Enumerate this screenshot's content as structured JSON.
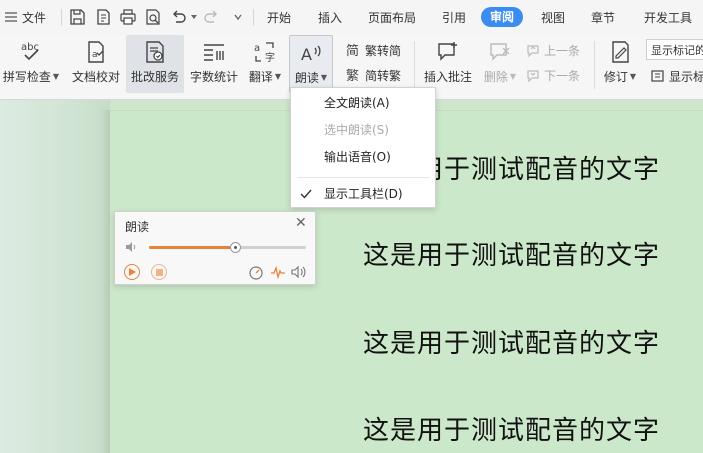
{
  "menubar": {
    "file_label": "文件",
    "tabs": [
      "开始",
      "插入",
      "页面布局",
      "引用",
      "审阅",
      "视图",
      "章节",
      "开发工具"
    ],
    "active_tab": "审阅"
  },
  "ribbon": {
    "spellcheck": "拼写检查",
    "doc_compare": "文档校对",
    "review_service": "批改服务",
    "word_count": "字数统计",
    "translate": "翻译",
    "read_aloud": "朗读",
    "trad_to_simp": "繁转简",
    "simp_to_trad": "简转繁",
    "insert_comment": "插入批注",
    "delete": "删除",
    "prev": "上一条",
    "next": "下一条",
    "revision": "修订",
    "show_markup_box": "显示标记的",
    "show_label": "显示标"
  },
  "dropdown": {
    "items": [
      "全文朗读(A)",
      "选中朗读(S)",
      "输出语音(O)",
      "显示工具栏(D)"
    ]
  },
  "toolbar": {
    "title": "朗读",
    "progress": 0.55
  },
  "document": {
    "lines": [
      "这是用于测试配音的文字",
      "这是用于测试配音的文字",
      "这是用于测试配音的文字",
      "这是用于测试配音的文字"
    ]
  },
  "colors": {
    "accent": "#3b8cf0",
    "progress": "#e8833a",
    "page": "#cce8ca"
  }
}
